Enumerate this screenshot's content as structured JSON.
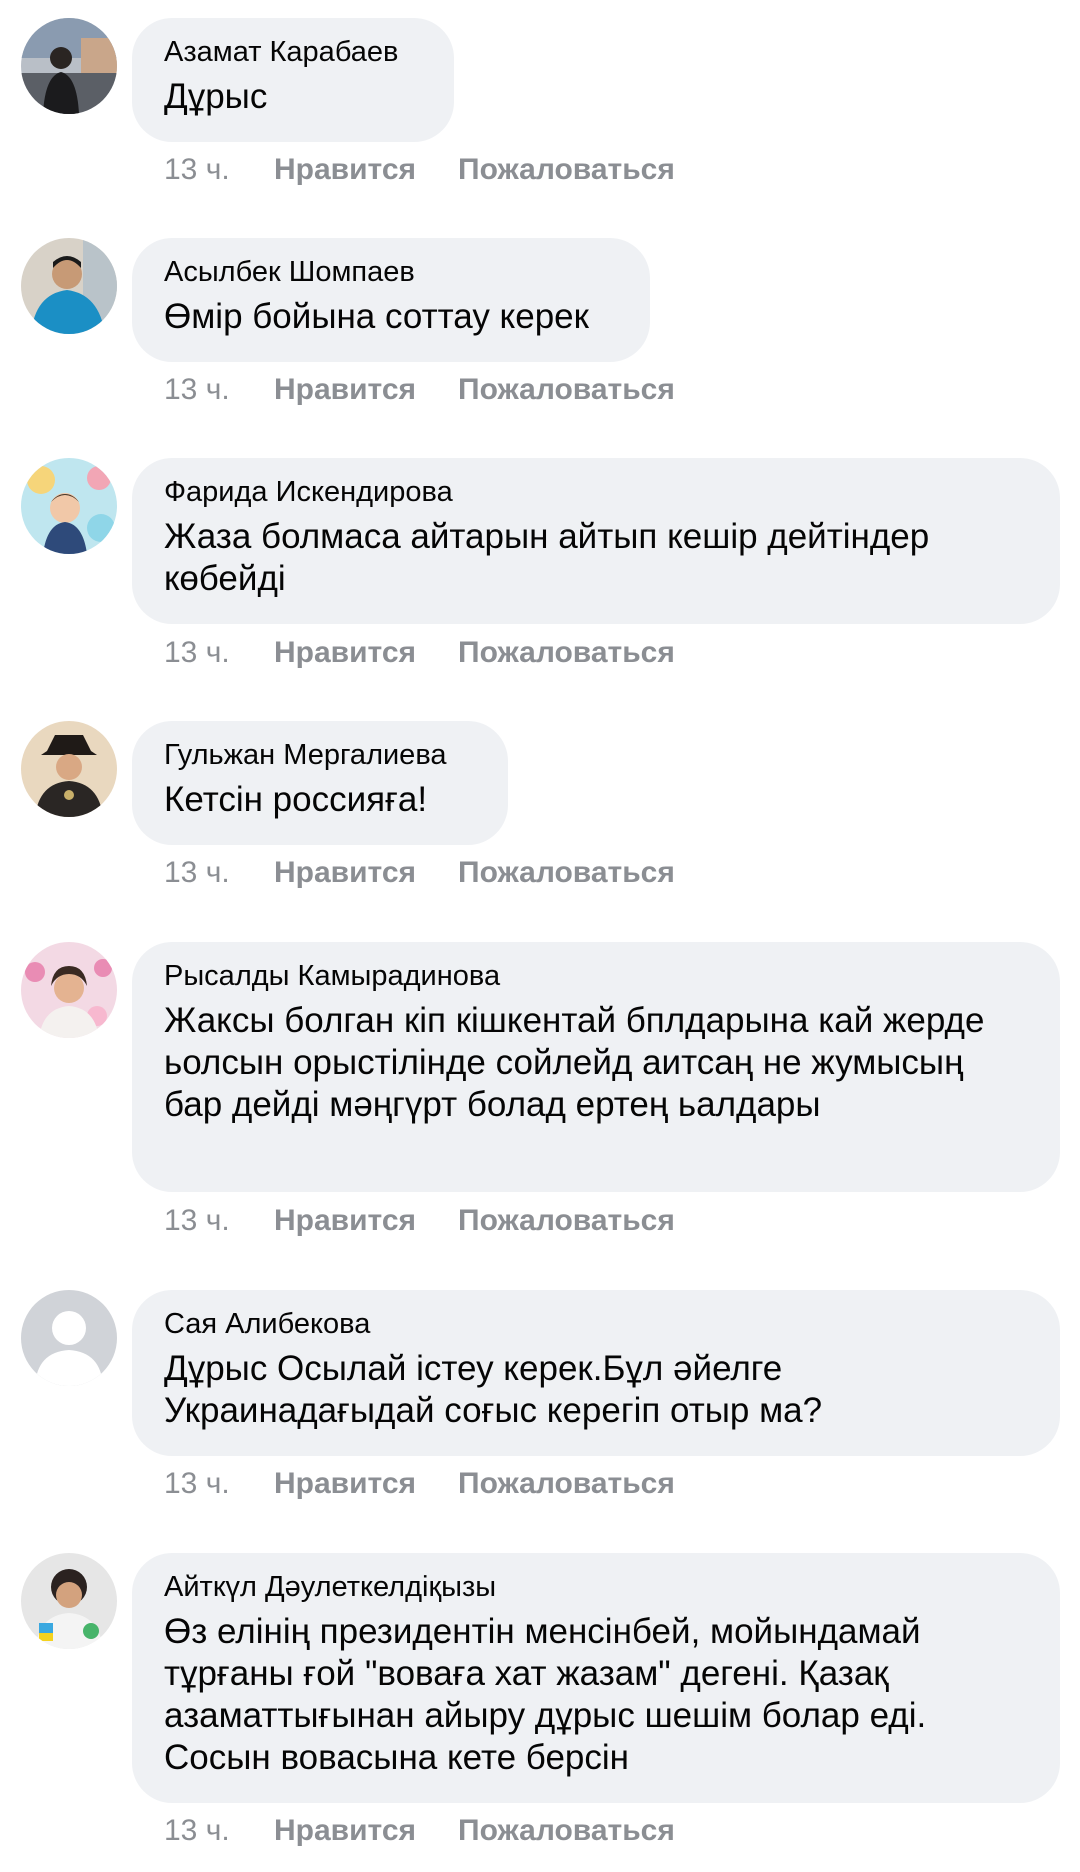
{
  "comments": [
    {
      "author": "Азамат Карабаев",
      "text": "Дұрыс",
      "time": "13 ч.",
      "like": "Нравится",
      "report": "Пожаловаться",
      "avatar_icon": "user-photo-icon"
    },
    {
      "author": "Асылбек Шомпаев",
      "text": "Өмір бойына соттау керек",
      "time": "13 ч.",
      "like": "Нравится",
      "report": "Пожаловаться",
      "avatar_icon": "user-photo-icon"
    },
    {
      "author": "Фарида Искендирова",
      "text": "Жаза болмаса айтарын айтып кешір дейтіндер көбейді",
      "time": "13 ч.",
      "like": "Нравится",
      "report": "Пожаловаться",
      "avatar_icon": "user-photo-icon"
    },
    {
      "author": "Гульжан Мергалиева",
      "text": "Кетсін россияға!",
      "time": "13 ч.",
      "like": "Нравится",
      "report": "Пожаловаться",
      "avatar_icon": "user-photo-icon"
    },
    {
      "author": "Рысалды Камырадинова",
      "text": "Жаксы болган кіп кішкентай бплдарына кай жерде ьолсын орыстілінде сойлейд аитсаң не жумысың бар дейді мәңгүрт болад ертең ьалдары",
      "time": "13 ч.",
      "like": "Нравится",
      "report": "Пожаловаться",
      "avatar_icon": "user-photo-icon"
    },
    {
      "author": "Сая Алибекова",
      "text": "Дұрыс Осылай істеу керек.Бұл әйелге Украинадағыдай соғыс керегіп отыр ма?",
      "time": "13 ч.",
      "like": "Нравится",
      "report": "Пожаловаться",
      "avatar_icon": "default-avatar-icon"
    },
    {
      "author": "Айткүл Дәулеткелдіқызы",
      "text": "Өз елінің президентін менсінбей, мойындамай тұрғаны ғой \"воваға хат жазам\" дегені. Қазақ азаматтығынан айыру дұрыс шешім болар еді. Сосын вовасына кете берсін",
      "time": "13 ч.",
      "like": "Нравится",
      "report": "Пожаловаться",
      "avatar_icon": "user-photo-icon"
    }
  ],
  "colors": {
    "bubble_bg": "#eff1f4",
    "text": "#050505",
    "meta": "#8b8e93"
  }
}
